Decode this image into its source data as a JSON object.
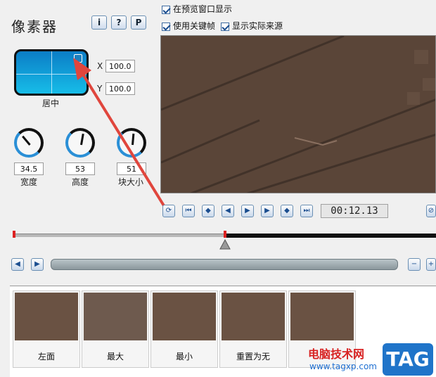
{
  "panel": {
    "title": "像素器",
    "help_buttons": [
      "i",
      "?",
      "P"
    ],
    "preview_label": "居中",
    "x_label": "X",
    "x_value": "100.0",
    "y_label": "Y",
    "y_value": "100.0"
  },
  "knobs": [
    {
      "value": "34.5",
      "label": "宽度"
    },
    {
      "value": "53",
      "label": "高度"
    },
    {
      "value": "51",
      "label": "块大小"
    }
  ],
  "options": {
    "preview_window": "在预览窗口显示",
    "use_keyframes": "使用关键帧",
    "show_source": "显示实际来源"
  },
  "playback": {
    "time": "00:12.13",
    "progress_fraction": 0.5
  },
  "presets": [
    {
      "label": "左面"
    },
    {
      "label": "最大"
    },
    {
      "label": "最小"
    },
    {
      "label": "重置为无"
    }
  ],
  "watermark": {
    "site_name": "电脑技术网",
    "url": "www.tagxp.com",
    "badge": "TAG"
  },
  "icons": {
    "accent": "#2a8fd6",
    "annotation_arrow": "#e0463d"
  }
}
